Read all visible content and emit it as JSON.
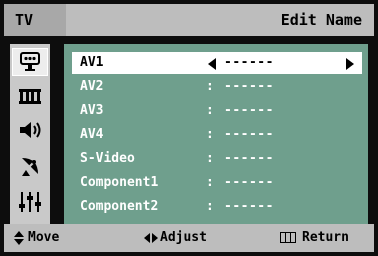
{
  "header": {
    "tv_label": "TV",
    "title": "Edit Name"
  },
  "sidebar": {
    "icons": [
      {
        "name": "input-icon",
        "active": true
      },
      {
        "name": "picture-icon",
        "active": false
      },
      {
        "name": "sound-icon",
        "active": false
      },
      {
        "name": "channel-icon",
        "active": false
      },
      {
        "name": "setup-icon",
        "active": false
      }
    ]
  },
  "rows": [
    {
      "label": "AV1",
      "separator": "",
      "value": "------",
      "selected": true
    },
    {
      "label": "AV2",
      "separator": ":",
      "value": "------",
      "selected": false
    },
    {
      "label": "AV3",
      "separator": ":",
      "value": "------",
      "selected": false
    },
    {
      "label": "AV4",
      "separator": ":",
      "value": "------",
      "selected": false
    },
    {
      "label": "S-Video",
      "separator": ":",
      "value": "------",
      "selected": false
    },
    {
      "label": "Component1",
      "separator": ":",
      "value": "------",
      "selected": false
    },
    {
      "label": "Component2",
      "separator": ":",
      "value": "------",
      "selected": false
    }
  ],
  "footer": {
    "move": "Move",
    "adjust": "Adjust",
    "return": "Return"
  },
  "colors": {
    "panel": "#6f9f8d",
    "bar": "#bdbdbd",
    "background": "#0d0d0d"
  }
}
